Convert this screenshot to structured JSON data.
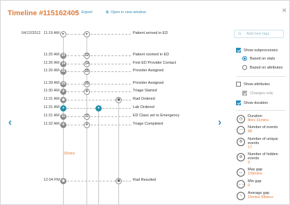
{
  "header": {
    "title": "Timeline #115162405",
    "export_label": "Export",
    "open_new_window_label": "Open in new window",
    "close_icon": "close-icon"
  },
  "tags": {
    "placeholder": "Add new tags"
  },
  "nav": {
    "prev": "‹",
    "next": "›"
  },
  "events": [
    {
      "date": "04/12/2012",
      "time": "11:19 AM",
      "badge": "",
      "label": "Patient arrived in ED"
    },
    {
      "date": "",
      "time": "11:25 AM",
      "badge": "22",
      "label": "Patient roomed in ED"
    },
    {
      "date": "",
      "time": "11:26 AM",
      "badge": "14",
      "label": "First ED Provider Contact"
    },
    {
      "date": "",
      "time": "11:26 AM",
      "badge": "25",
      "label": "Provider Assigned"
    },
    {
      "date": "",
      "time": "11:28 AM",
      "badge": "25",
      "label": "Provider Assigned"
    },
    {
      "date": "",
      "time": "11:30 AM",
      "badge": "",
      "label": "Triage Started"
    },
    {
      "date": "",
      "time": "11:31 AM",
      "badge": "",
      "label": "Rad Ordered"
    },
    {
      "date": "",
      "time": "11:31 AM",
      "badge": "",
      "label": "Lab Ordered"
    },
    {
      "date": "",
      "time": "11:31 AM",
      "badge": "11",
      "label": "ED Class set to Emergency"
    },
    {
      "date": "",
      "time": "11:32 AM",
      "badge": "",
      "label": "Triage Completed"
    },
    {
      "date": "",
      "time": "12:04 PM",
      "badge": "",
      "label": "Rad Resulted"
    }
  ],
  "gap_label": "32mins",
  "options": {
    "show_subprocesses": "Show subprocesses",
    "based_on_stats": "Based on stats",
    "based_on_attributes": "Based on attributes",
    "show_attributes": "Show attributes",
    "changes_only": "Changes only",
    "show_duration": "Show duration"
  },
  "stats": [
    {
      "label": "Duration",
      "value": "8hrs 31mins",
      "icon": "clock-icon"
    },
    {
      "label": "Number of events",
      "value": "88",
      "icon": "events-icon"
    },
    {
      "label": "Number of unique events",
      "value": "17",
      "icon": "unique-events-icon"
    },
    {
      "label": "Number of hidden events",
      "value": "0",
      "icon": "hidden-events-icon"
    },
    {
      "label": "Max gap",
      "value": "109mins",
      "icon": "max-gap-icon"
    },
    {
      "label": "Min gap",
      "value": "0",
      "icon": "min-gap-icon"
    },
    {
      "label": "Average gap",
      "value": "15mins 58secs",
      "icon": "average-gap-icon"
    }
  ],
  "colors": {
    "accent": "#2a8fbd",
    "title": "#e07b39",
    "teal": "#1f8fa8"
  }
}
